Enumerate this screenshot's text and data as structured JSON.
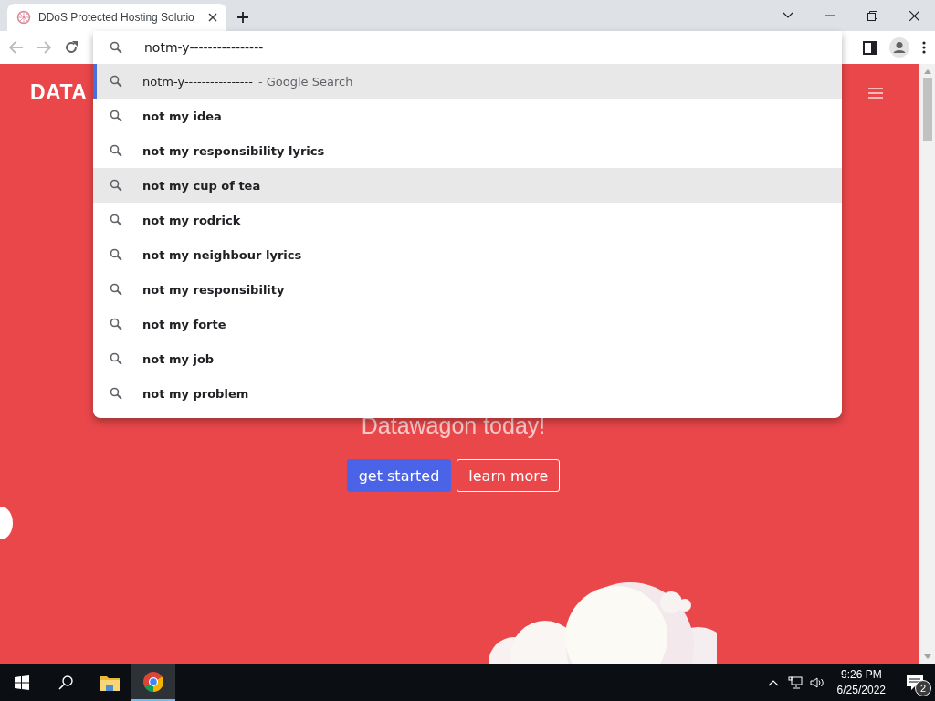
{
  "tab": {
    "title": "DDoS Protected Hosting Solutio"
  },
  "omnibox": {
    "value": "notm-y----------------"
  },
  "suggestions": [
    {
      "text": "notm-y----------------",
      "hint": "- Google Search",
      "selected": true,
      "highlighted": true
    },
    {
      "text": "not my idea",
      "selected": false,
      "highlighted": false
    },
    {
      "text": "not my responsibility lyrics",
      "selected": false,
      "highlighted": false
    },
    {
      "text": "not my cup of tea",
      "selected": false,
      "highlighted": true
    },
    {
      "text": "not my rodrick",
      "selected": false,
      "highlighted": false
    },
    {
      "text": "not my neighbour lyrics",
      "selected": false,
      "highlighted": false
    },
    {
      "text": "not my responsibility",
      "selected": false,
      "highlighted": false
    },
    {
      "text": "not my forte",
      "selected": false,
      "highlighted": false
    },
    {
      "text": "not my job",
      "selected": false,
      "highlighted": false
    },
    {
      "text": "not my problem",
      "selected": false,
      "highlighted": false
    }
  ],
  "page": {
    "logo": "DATA",
    "tagline": "Datawagon today!",
    "buttons": [
      {
        "label": "get started",
        "kind": "primary"
      },
      {
        "label": "learn more",
        "kind": "outline"
      }
    ]
  },
  "taskbar": {
    "time": "9:26 PM",
    "date": "6/25/2022",
    "notifications": "2"
  }
}
